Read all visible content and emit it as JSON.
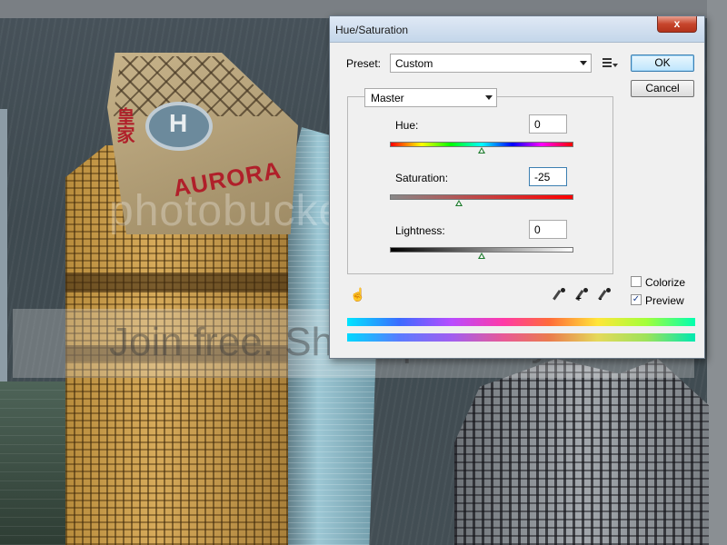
{
  "dialog": {
    "title": "Hue/Saturation",
    "close_glyph": "x",
    "preset": {
      "label": "Preset:",
      "value": "Custom"
    },
    "channel": {
      "value": "Master"
    },
    "hue": {
      "label": "Hue:",
      "value": "0",
      "position": 0.5
    },
    "saturation": {
      "label": "Saturation:",
      "value": "-25",
      "position": 0.375
    },
    "lightness": {
      "label": "Lightness:",
      "value": "0",
      "position": 0.5
    },
    "buttons": {
      "ok": "OK",
      "cancel": "Cancel"
    },
    "colorize": {
      "label": "Colorize",
      "checked": false
    },
    "preview": {
      "label": "Preview",
      "checked": true,
      "mark": "✓"
    },
    "eyedropper_add_mark": "+",
    "eyedropper_sub_mark": "-",
    "hand_glyph": "☝"
  },
  "background": {
    "sign_side": "皇家",
    "sign_text": "AURORA",
    "helipad_letter": "H",
    "watermark_logo": "photobucket",
    "watermark_tagline": "Join free. Share privately."
  }
}
